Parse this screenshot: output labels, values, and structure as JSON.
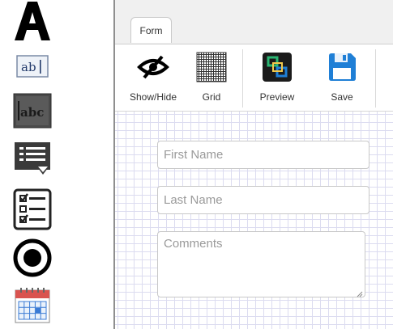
{
  "palette": {
    "items": [
      {
        "icon": "text-label-icon"
      },
      {
        "icon": "textbox-icon"
      },
      {
        "icon": "textarea-icon"
      },
      {
        "icon": "dropdown-list-icon"
      },
      {
        "icon": "checklist-icon"
      },
      {
        "icon": "radio-button-icon"
      },
      {
        "icon": "calendar-icon"
      }
    ]
  },
  "tabs": [
    {
      "label": "Form"
    }
  ],
  "toolbar": {
    "items": [
      {
        "label": "Show/Hide",
        "icon": "eye-slash-icon"
      },
      {
        "label": "Grid",
        "icon": "grid-icon"
      },
      {
        "label": "Preview",
        "icon": "preview-icon"
      },
      {
        "label": "Save",
        "icon": "floppy-disk-icon"
      }
    ]
  },
  "form": {
    "first_name": {
      "placeholder": "First Name",
      "value": ""
    },
    "last_name": {
      "placeholder": "Last Name",
      "value": ""
    },
    "comments": {
      "placeholder": "Comments",
      "value": ""
    }
  },
  "colors": {
    "divider": "#8f8f8f",
    "grid_line": "#dcdcf0",
    "save_blue": "#1f7fd6",
    "preview_green": "#2bb673"
  }
}
